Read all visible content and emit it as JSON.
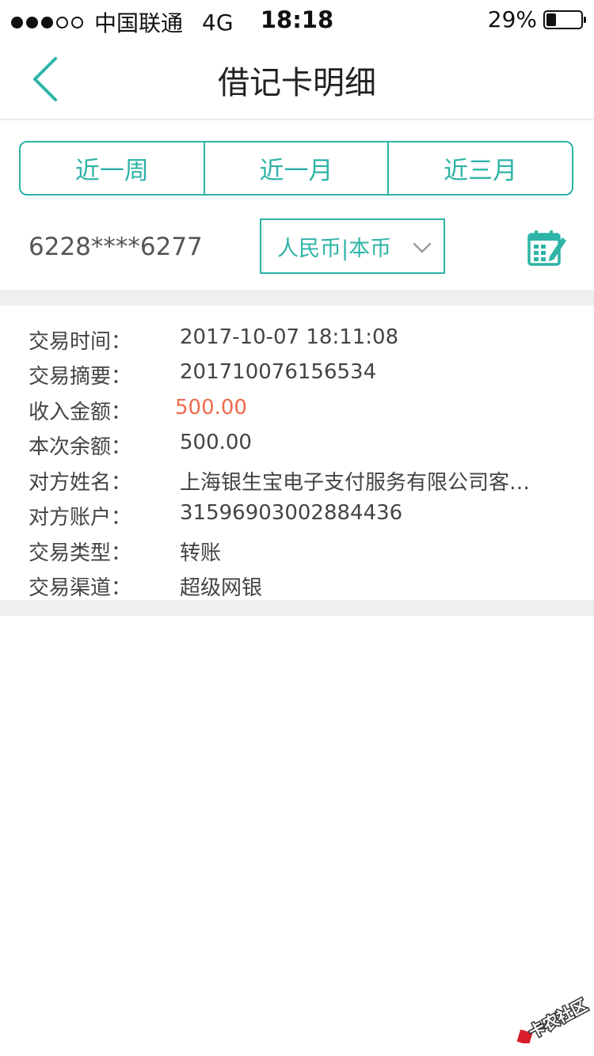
{
  "status_bar": {
    "carrier": "中国联通",
    "network": "4G",
    "time": "18:18",
    "battery_percent": "29%",
    "battery_level": 0.29,
    "signal_bars_filled": 3,
    "signal_bars_total": 5
  },
  "nav": {
    "title": "借记卡明细",
    "back_icon": "chevron-left-icon"
  },
  "period_tabs": [
    {
      "label": "近一周"
    },
    {
      "label": "近一月"
    },
    {
      "label": "近三月"
    }
  ],
  "account": {
    "card_number": "6228****6277",
    "currency_selected": "人民币|本币",
    "calendar_icon": "calendar-edit-icon"
  },
  "transaction": {
    "rows": [
      {
        "label": "交易时间：",
        "value": "2017-10-07 18:11:08"
      },
      {
        "label": "交易摘要：",
        "value": "201710076156534"
      },
      {
        "label": "收入金额：",
        "value": "500.00"
      },
      {
        "label": "本次余额：",
        "value": "500.00"
      },
      {
        "label": "对方姓名：",
        "value": "上海银生宝电子支付服务有限公司客…"
      },
      {
        "label": "对方账户：",
        "value": "31596903002884436"
      },
      {
        "label": "交易类型：",
        "value": "转账"
      },
      {
        "label": "交易渠道：",
        "value": "超级网银"
      }
    ]
  },
  "watermark": {
    "text": "卡农社区"
  },
  "colors": {
    "accent": "#2db4a6",
    "income": "#ee6b4d",
    "band": "#efefef"
  }
}
